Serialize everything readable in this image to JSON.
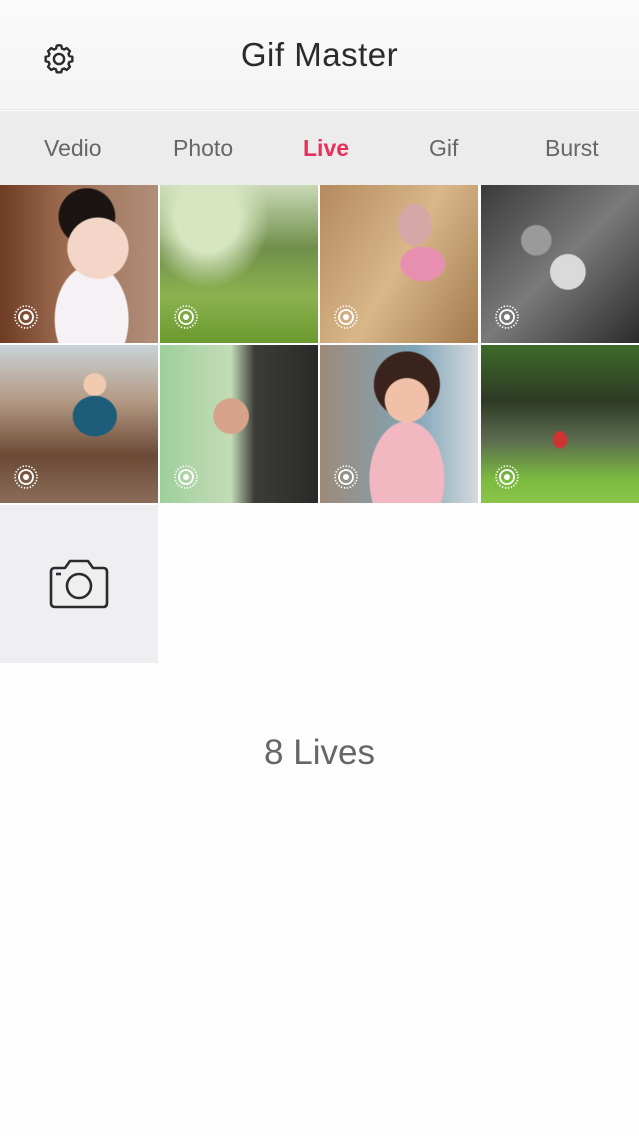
{
  "header": {
    "title": "Gif Master",
    "settings_icon": "gear-icon"
  },
  "tabs": [
    {
      "label": "Vedio",
      "active": false
    },
    {
      "label": "Photo",
      "active": false
    },
    {
      "label": "Live",
      "active": true
    },
    {
      "label": "Gif",
      "active": false
    },
    {
      "label": "Burst",
      "active": false
    }
  ],
  "colors": {
    "accent": "#e8305a",
    "tab_bar": "#ececec",
    "header_bg": "#f6f6f6"
  },
  "thumbnails": [
    {
      "badge_icon": "live-photo-icon"
    },
    {
      "badge_icon": "live-photo-icon"
    },
    {
      "badge_icon": "live-photo-icon"
    },
    {
      "badge_icon": "live-photo-icon"
    },
    {
      "badge_icon": "live-photo-icon"
    },
    {
      "badge_icon": "live-photo-icon"
    },
    {
      "badge_icon": "live-photo-icon"
    },
    {
      "badge_icon": "live-photo-icon"
    }
  ],
  "camera_button_icon": "camera-icon",
  "footer": {
    "count_label": "8 Lives"
  }
}
